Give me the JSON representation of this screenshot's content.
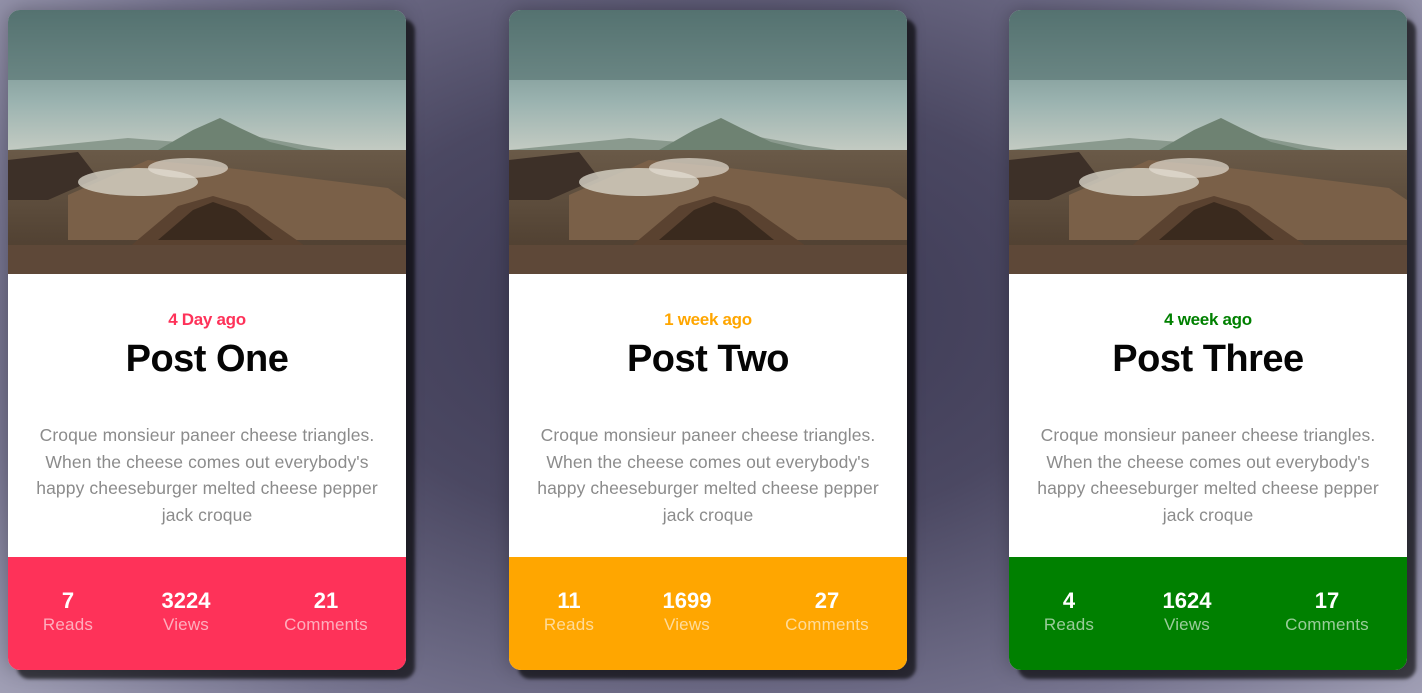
{
  "cards": [
    {
      "time": "4 Day ago",
      "title": "Post One",
      "description": "Croque monsieur paneer cheese triangles. When the cheese comes out everybody's happy cheeseburger melted cheese pepper jack croque",
      "accent_color": "#fe3259",
      "stats": [
        {
          "value": "7",
          "label": "Reads"
        },
        {
          "value": "3224",
          "label": "Views"
        },
        {
          "value": "21",
          "label": "Comments"
        }
      ]
    },
    {
      "time": "1 week ago",
      "title": "Post Two",
      "description": "Croque monsieur paneer cheese triangles. When the cheese comes out everybody's happy cheeseburger melted cheese pepper jack croque",
      "accent_color": "#ffa600",
      "stats": [
        {
          "value": "11",
          "label": "Reads"
        },
        {
          "value": "1699",
          "label": "Views"
        },
        {
          "value": "27",
          "label": "Comments"
        }
      ]
    },
    {
      "time": "4 week ago",
      "title": "Post Three",
      "description": "Croque monsieur paneer cheese triangles. When the cheese comes out everybody's happy cheeseburger melted cheese pepper jack croque",
      "accent_color": "#008000",
      "stats": [
        {
          "value": "4",
          "label": "Reads"
        },
        {
          "value": "1624",
          "label": "Views"
        },
        {
          "value": "17",
          "label": "Comments"
        }
      ]
    }
  ]
}
